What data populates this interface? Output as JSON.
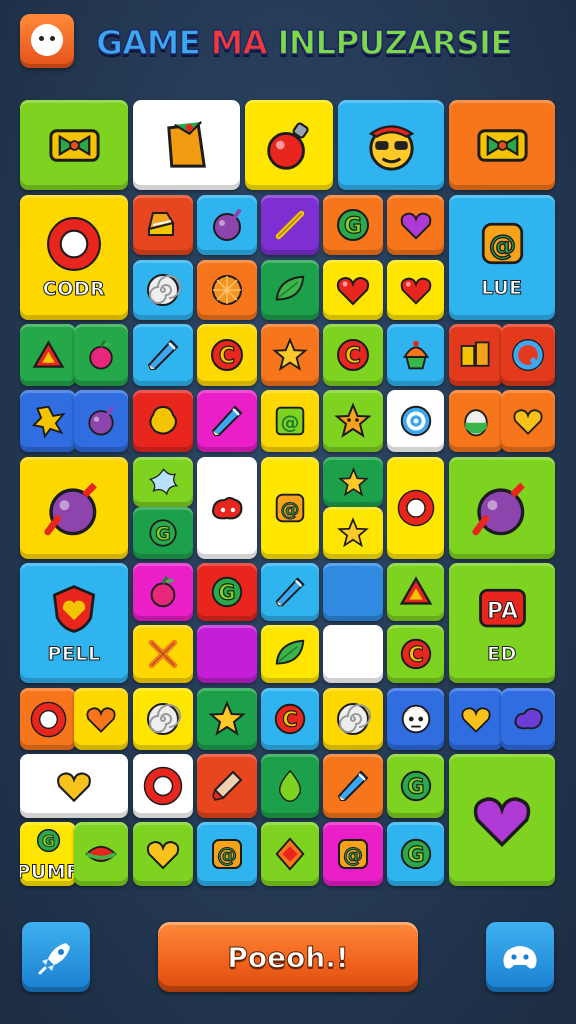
{
  "header": {
    "title_parts": [
      {
        "text": "GAME ",
        "color": "#3ea7f2"
      },
      {
        "text": "MA ",
        "color": "#f2393a"
      },
      {
        "text": "INLPUZARSIE",
        "color": "#7dd84a"
      }
    ]
  },
  "tiles": [
    {
      "icon": "bow-icon",
      "color": "#7ed321"
    },
    {
      "icon": "taco-icon",
      "color": "#ffffff"
    },
    {
      "icon": "red-bomb-icon",
      "color": "#ffe600"
    },
    {
      "icon": "sunglasses-face-icon",
      "color": "#2fb4ef"
    },
    {
      "icon": "bow-icon",
      "color": "#f7761c"
    },
    {
      "icon": "o-ring-icon",
      "color": "#ffd800",
      "label": "CODR"
    },
    {
      "icon": "cake-icon",
      "color": "#e8461e"
    },
    {
      "icon": "purple-ball-icon",
      "color": "#2fb4ef"
    },
    {
      "icon": "stick-icon",
      "color": "#7e2fd1"
    },
    {
      "icon": "letter-g-icon",
      "color": "#f7761c"
    },
    {
      "icon": "purple-heart-icon",
      "color": "#f7761c"
    },
    {
      "icon": "letter-a-icon",
      "color": "#2fb4ef",
      "label": "LUE"
    },
    {
      "icon": "swirl-icon",
      "color": "#2fb4ef"
    },
    {
      "icon": "orange-fruit-icon",
      "color": "#f7761c"
    },
    {
      "icon": "leaf-icon",
      "color": "#1da04a"
    },
    {
      "icon": "red-heart-icon",
      "color": "#ffe600"
    },
    {
      "icon": "red-heart-icon",
      "color": "#ffe600"
    },
    {
      "icon": "triangle-icon",
      "color": "#24a84a"
    },
    {
      "icon": "apple-icon",
      "color": "#24a84a"
    },
    {
      "icon": "pencil-icon",
      "color": "#2fb4ef"
    },
    {
      "icon": "letter-c-icon",
      "color": "#ffd800"
    },
    {
      "icon": "star-icon",
      "color": "#f7761c"
    },
    {
      "icon": "letter-c-icon",
      "color": "#7ed321"
    },
    {
      "icon": "cupcake-icon",
      "color": "#2fb4ef"
    },
    {
      "icon": "block-letters-icon",
      "color": "#e33a1e"
    },
    {
      "icon": "letter-q-icon",
      "color": "#e33a1e"
    },
    {
      "icon": "splat-icon",
      "color": "#2f6de0"
    },
    {
      "icon": "purple-ball-icon",
      "color": "#2f6de0"
    },
    {
      "icon": "yellow-splat-icon",
      "color": "#e8261e"
    },
    {
      "icon": "pencil-icon",
      "color": "#ea1fc8"
    },
    {
      "icon": "at-sign-icon",
      "color": "#ffd800"
    },
    {
      "icon": "star-face-icon",
      "color": "#7ed321"
    },
    {
      "icon": "target-icon",
      "color": "#ffffff"
    },
    {
      "icon": "egg-icon",
      "color": "#f7761c"
    },
    {
      "icon": "yellow-heart-icon",
      "color": "#f7761c"
    },
    {
      "icon": "purple-bomb-icon",
      "color": "#ffd800"
    },
    {
      "icon": "flower-icon",
      "color": "#7ed321"
    },
    {
      "icon": "letter-g-icon",
      "color": "#1da04a"
    },
    {
      "icon": "red-blob-icon",
      "color": "#ffffff"
    },
    {
      "icon": "letter-a-icon",
      "color": "#ffe600"
    },
    {
      "icon": "star-icon",
      "color": "#1da04a"
    },
    {
      "icon": "star-icon",
      "color": "#ffe600"
    },
    {
      "icon": "o-ring-icon",
      "color": "#ffe600"
    },
    {
      "icon": "purple-bomb-icon",
      "color": "#7ed321"
    },
    {
      "icon": "shield-icon",
      "color": "#2fb4ef",
      "label": "PELL"
    },
    {
      "icon": "apple-icon",
      "color": "#ea1fc8"
    },
    {
      "icon": "letter-g-icon",
      "color": "#e8261e"
    },
    {
      "icon": "pencil-icon",
      "color": "#2fb4ef"
    },
    {
      "icon": "blank-icon",
      "color": "#2f8ae0"
    },
    {
      "icon": "triangle-icon",
      "color": "#7ed321"
    },
    {
      "icon": "pa-badge-icon",
      "color": "#7ed321",
      "label": "ED"
    },
    {
      "icon": "cross-icon",
      "color": "#ffd800"
    },
    {
      "icon": "blank-icon",
      "color": "#c41fd6"
    },
    {
      "icon": "leaf-icon",
      "color": "#ffe600"
    },
    {
      "icon": "blank-icon",
      "color": "#ffffff"
    },
    {
      "icon": "letter-c-icon",
      "color": "#7ed321"
    },
    {
      "icon": "o-ring-icon",
      "color": "#f7761c"
    },
    {
      "icon": "orange-heart-icon",
      "color": "#ffd800"
    },
    {
      "icon": "swirl-icon",
      "color": "#ffe600"
    },
    {
      "icon": "star-icon",
      "color": "#1da04a"
    },
    {
      "icon": "letter-c-icon",
      "color": "#2fb4ef"
    },
    {
      "icon": "swirl-icon",
      "color": "#ffd800"
    },
    {
      "icon": "skull-face-icon",
      "color": "#2f6de0"
    },
    {
      "icon": "yellow-heart-icon",
      "color": "#2f6de0"
    },
    {
      "icon": "purple-blob-icon",
      "color": "#2f6de0"
    },
    {
      "icon": "yellow-heart-icon",
      "color": "#ffffff"
    },
    {
      "icon": "o-ring-icon",
      "color": "#ffffff"
    },
    {
      "icon": "brush-icon",
      "color": "#e8461e"
    },
    {
      "icon": "green-drop-icon",
      "color": "#1da04a"
    },
    {
      "icon": "pencil-icon",
      "color": "#f7761c"
    },
    {
      "icon": "letter-g-icon",
      "color": "#7ed321"
    },
    {
      "icon": "purple-heart-icon",
      "color": "#7ed321"
    },
    {
      "icon": "letter-g-icon",
      "color": "#ffe600",
      "label": "PUMF"
    },
    {
      "icon": "watermelon-icon",
      "color": "#7ed321"
    },
    {
      "icon": "yellow-heart-icon",
      "color": "#7ed321"
    },
    {
      "icon": "letter-a-icon",
      "color": "#2fb4ef"
    },
    {
      "icon": "orange-diamond-icon",
      "color": "#7ed321"
    },
    {
      "icon": "letter-a-icon",
      "color": "#ea1fc8"
    },
    {
      "icon": "letter-g-icon",
      "color": "#2fb4ef"
    },
    {
      "icon": "yellow-bell-icon",
      "color": "#7ed321"
    }
  ],
  "bottom_bar": {
    "main_button_label": "Poeoh.!",
    "left_button_icon": "rocket-icon",
    "right_button_icon": "gamepad-icon"
  }
}
